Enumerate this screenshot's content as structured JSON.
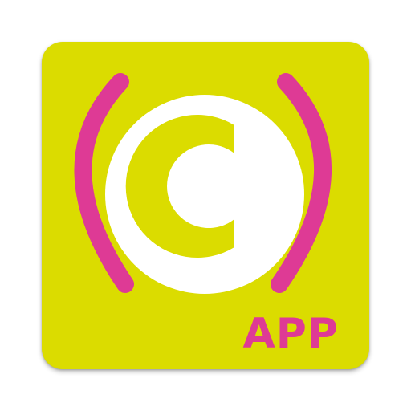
{
  "app_icon": {
    "label": "APP",
    "logo_letter_icon": "c-logo-icon",
    "left_wave_icon": "broadcast-wave-left-icon",
    "right_wave_icon": "broadcast-wave-right-icon",
    "colors": {
      "tile_background": "#dbdc00",
      "wave": "#de3a95",
      "circle": "#ffffff",
      "letter": "#dbdc00",
      "label": "#de3a95"
    }
  }
}
